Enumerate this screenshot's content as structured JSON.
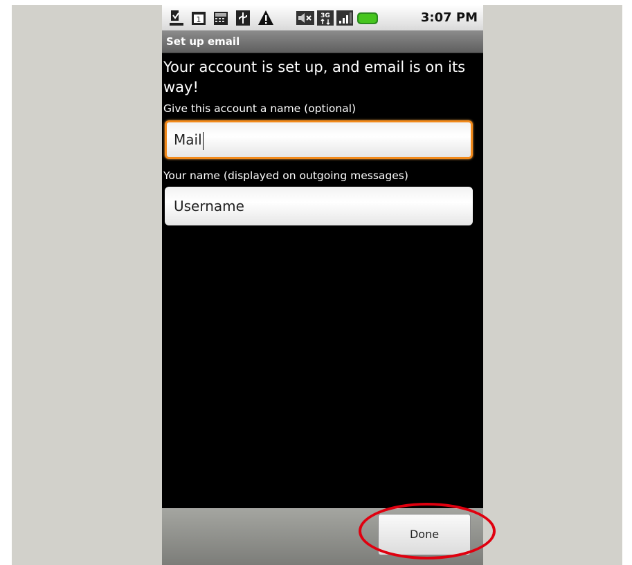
{
  "status_bar": {
    "time": "3:07 PM",
    "icons": [
      "download-icon",
      "calendar-icon",
      "keyboard-icon",
      "usb-icon",
      "warning-icon",
      "mute-icon",
      "3g-icon",
      "signal-icon",
      "battery-icon"
    ]
  },
  "title_bar": {
    "title": "Set up email"
  },
  "content": {
    "headline": "Your account is set up, and email is on its way!",
    "account_name_label": "Give this account a name (optional)",
    "account_name_value": "Mail",
    "your_name_label": "Your name (displayed on outgoing messages)",
    "your_name_value": "Username"
  },
  "bottom_bar": {
    "done_label": "Done"
  },
  "colors": {
    "focus_border": "#f28a1b",
    "highlight": "#e0000f",
    "background": "#d2d1cb"
  }
}
